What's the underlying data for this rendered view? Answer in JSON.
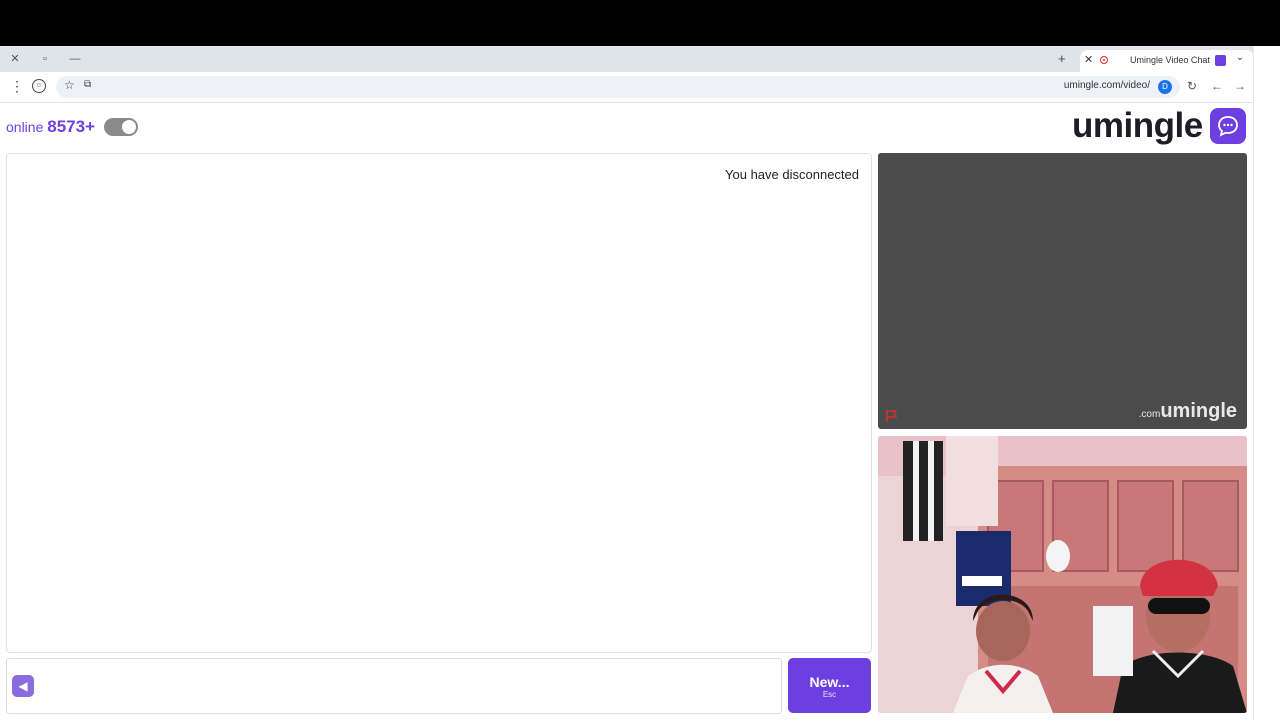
{
  "browser": {
    "tab_title": "Umingle Video Chat with S",
    "url": "umingle.com/video/",
    "site_icon_glyph": "D"
  },
  "header": {
    "brand": "umingle",
    "online_count": "8573+",
    "online_label": "online"
  },
  "chat": {
    "status_message": "You have disconnected"
  },
  "controls": {
    "new_button_label": "New...",
    "new_button_shortcut": "Esc",
    "message_placeholder": "",
    "send_icon": "send-arrow-icon"
  },
  "video": {
    "watermark_brand": "umingle",
    "watermark_domain": ".com"
  },
  "colors": {
    "accent": "#6d3fe0",
    "video_placeholder": "#4b4b4b"
  }
}
